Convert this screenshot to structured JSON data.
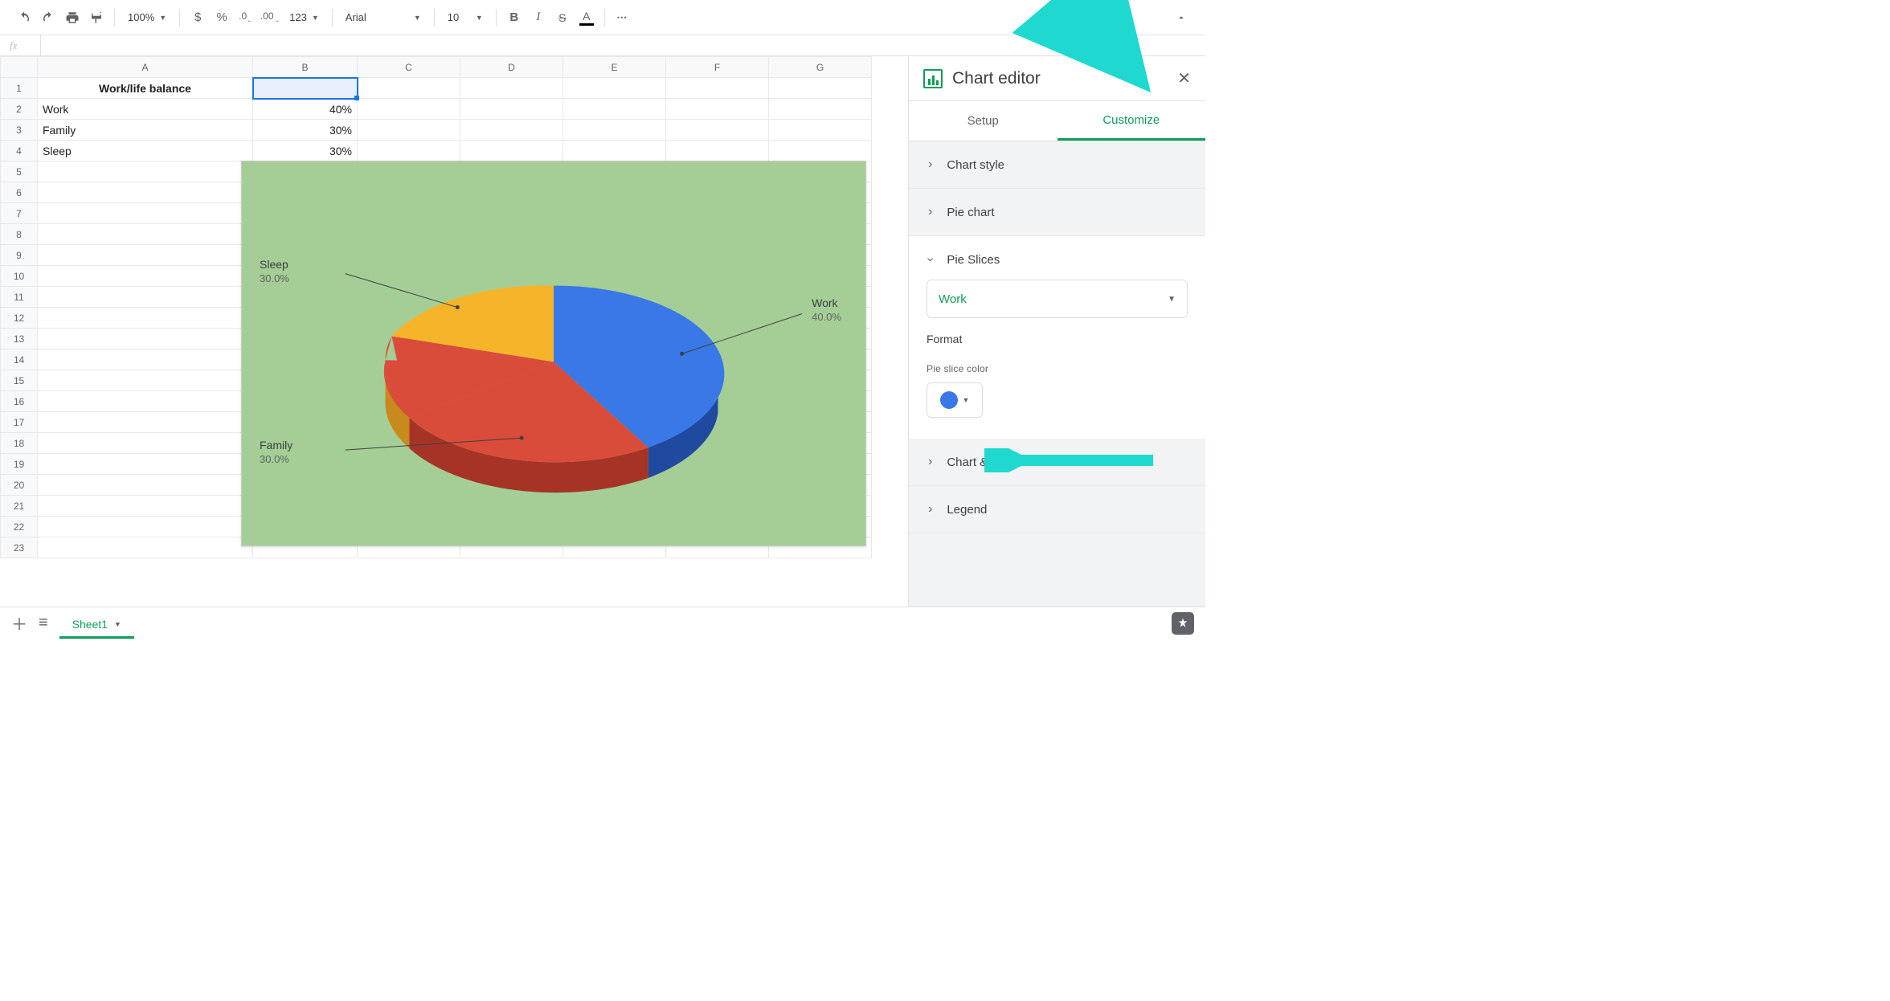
{
  "toolbar": {
    "zoom": "100%",
    "font": "Arial",
    "fontsize": "10",
    "number_format_label": "123"
  },
  "formula": {
    "fx": "fx",
    "value": ""
  },
  "grid": {
    "columns": [
      "A",
      "B",
      "C",
      "D",
      "E",
      "F",
      "G"
    ],
    "rows": 23,
    "cells": {
      "A1": "Work/life balance",
      "A2": "Work",
      "B2": "40%",
      "A3": "Family",
      "B3": "30%",
      "A4": "Sleep",
      "B4": "30%"
    },
    "selected": "B1"
  },
  "chart_data": {
    "type": "pie",
    "title": "",
    "categories": [
      "Work",
      "Family",
      "Sleep"
    ],
    "values": [
      40,
      30,
      30
    ],
    "labels": [
      "Work",
      "Family",
      "Sleep"
    ],
    "pct_labels": [
      "40.0%",
      "30.0%",
      "30.0%"
    ],
    "colors": [
      "#3b78e7",
      "#d94c3a",
      "#f6b42b"
    ],
    "background": "#a5ce96",
    "style": "3d"
  },
  "panel": {
    "title": "Chart editor",
    "tabs": [
      "Setup",
      "Customize"
    ],
    "active_tab": "Customize",
    "sections": {
      "chart_style": "Chart style",
      "pie_chart": "Pie chart",
      "pie_slices": "Pie Slices",
      "chart_axis_titles": "Chart & axis titles",
      "legend": "Legend"
    },
    "pie_slices": {
      "selected_slice": "Work",
      "format_label": "Format",
      "color_label": "Pie slice color",
      "color_value": "#3b78e7"
    }
  },
  "sheets": {
    "sheet_name": "Sheet1"
  }
}
